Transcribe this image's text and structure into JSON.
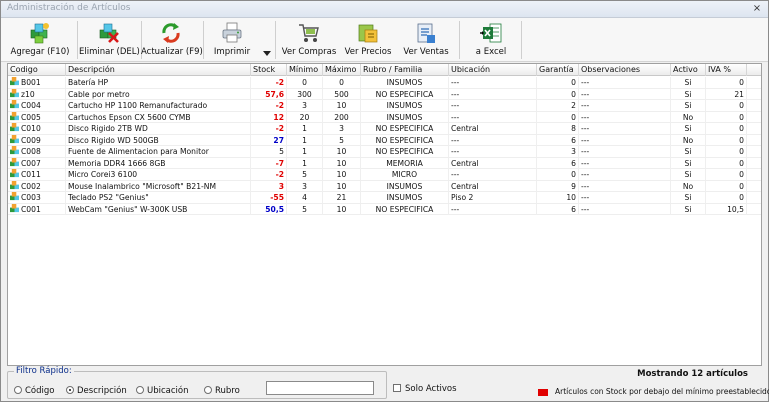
{
  "window": {
    "title": "Administración de Artículos",
    "close_glyph": "×"
  },
  "toolbar": {
    "buttons": [
      {
        "label": "Agregar (F10)",
        "icon": "add-cubes-icon"
      },
      {
        "label": "Eliminar (DEL)",
        "icon": "delete-cubes-icon"
      },
      {
        "label": "Actualizar (F9)",
        "icon": "refresh-icon"
      },
      {
        "label": "Imprimir",
        "icon": "printer-icon"
      },
      {
        "label": "Ver Compras",
        "icon": "cart-icon"
      },
      {
        "label": "Ver Precios",
        "icon": "price-icon"
      },
      {
        "label": "Ver Ventas",
        "icon": "sales-icon"
      },
      {
        "label": "a Excel",
        "icon": "excel-icon"
      }
    ]
  },
  "grid": {
    "headers": [
      "Codigo",
      "Descripción",
      "Stock",
      "Mínimo",
      "Máximo",
      "Rubro / Familia",
      "Ubicación",
      "Garantía",
      "Observaciones",
      "Activo",
      "IVA %"
    ],
    "rows": [
      {
        "codigo": "B001",
        "descripcion": "Batería HP",
        "stock": "-2",
        "stock_state": "neg",
        "minimo": "0",
        "maximo": "0",
        "rubro": "INSUMOS",
        "ubicacion": "---",
        "garantia": "0",
        "observaciones": "---",
        "activo": "Si",
        "iva": "0"
      },
      {
        "codigo": "z10",
        "descripcion": "Cable por metro",
        "stock": "57,6",
        "stock_state": "neg",
        "minimo": "300",
        "maximo": "500",
        "rubro": "NO ESPECIFICA",
        "ubicacion": "---",
        "garantia": "0",
        "observaciones": "---",
        "activo": "Si",
        "iva": "21"
      },
      {
        "codigo": "C004",
        "descripcion": "Cartucho HP 1100 Remanufacturado",
        "stock": "-2",
        "stock_state": "neg",
        "minimo": "3",
        "maximo": "10",
        "rubro": "INSUMOS",
        "ubicacion": "---",
        "garantia": "2",
        "observaciones": "---",
        "activo": "Si",
        "iva": "0"
      },
      {
        "codigo": "C005",
        "descripcion": "Cartuchos Epson CX 5600 CYMB",
        "stock": "12",
        "stock_state": "neg",
        "minimo": "20",
        "maximo": "200",
        "rubro": "INSUMOS",
        "ubicacion": "---",
        "garantia": "0",
        "observaciones": "---",
        "activo": "No",
        "iva": "0"
      },
      {
        "codigo": "C010",
        "descripcion": "Disco Rigido 2TB WD",
        "stock": "-2",
        "stock_state": "neg",
        "minimo": "1",
        "maximo": "3",
        "rubro": "NO ESPECIFICA",
        "ubicacion": "Central",
        "garantia": "8",
        "observaciones": "---",
        "activo": "Si",
        "iva": "0"
      },
      {
        "codigo": "C009",
        "descripcion": "Disco Rigido WD 500GB",
        "stock": "27",
        "stock_state": "pos",
        "minimo": "1",
        "maximo": "5",
        "rubro": "NO ESPECIFICA",
        "ubicacion": "---",
        "garantia": "6",
        "observaciones": "---",
        "activo": "No",
        "iva": "0"
      },
      {
        "codigo": "C008",
        "descripcion": "Fuente de Alimentacion para Monitor",
        "stock": "5",
        "stock_state": "normal",
        "minimo": "1",
        "maximo": "10",
        "rubro": "NO ESPECIFICA",
        "ubicacion": "---",
        "garantia": "3",
        "observaciones": "---",
        "activo": "Si",
        "iva": "0"
      },
      {
        "codigo": "C007",
        "descripcion": "Memoria DDR4 1666 8GB",
        "stock": "-7",
        "stock_state": "neg",
        "minimo": "1",
        "maximo": "10",
        "rubro": "MEMORIA",
        "ubicacion": "Central",
        "garantia": "6",
        "observaciones": "---",
        "activo": "Si",
        "iva": "0"
      },
      {
        "codigo": "C011",
        "descripcion": "Micro Corei3 6100",
        "stock": "-2",
        "stock_state": "neg",
        "minimo": "5",
        "maximo": "10",
        "rubro": "MICRO",
        "ubicacion": "---",
        "garantia": "0",
        "observaciones": "---",
        "activo": "Si",
        "iva": "0"
      },
      {
        "codigo": "C002",
        "descripcion": "Mouse Inalambrico \"Microsoft\" B21-NM",
        "stock": "3",
        "stock_state": "neg",
        "minimo": "3",
        "maximo": "10",
        "rubro": "INSUMOS",
        "ubicacion": "Central",
        "garantia": "9",
        "observaciones": "---",
        "activo": "No",
        "iva": "0"
      },
      {
        "codigo": "C003",
        "descripcion": "Teclado PS2 \"Genius\"",
        "stock": "-55",
        "stock_state": "neg",
        "minimo": "4",
        "maximo": "21",
        "rubro": "INSUMOS",
        "ubicacion": "Piso 2",
        "garantia": "10",
        "observaciones": "---",
        "activo": "Si",
        "iva": "0"
      },
      {
        "codigo": "C001",
        "descripcion": "WebCam \"Genius\" W-300K USB",
        "stock": "50,5",
        "stock_state": "pos",
        "minimo": "5",
        "maximo": "10",
        "rubro": "NO ESPECIFICA",
        "ubicacion": "---",
        "garantia": "6",
        "observaciones": "---",
        "activo": "Si",
        "iva": "10,5"
      }
    ]
  },
  "filter": {
    "title": "Filtro Rápido:",
    "options": [
      {
        "label": "Código",
        "selected": false
      },
      {
        "label": "Descripción",
        "selected": true
      },
      {
        "label": "Ubicación",
        "selected": false
      },
      {
        "label": "Rubro",
        "selected": false
      }
    ],
    "search_value": "",
    "solo_activos_label": "Solo Activos",
    "solo_activos_checked": false
  },
  "status": {
    "count_text": "Mostrando 12 artículos",
    "legend_text": "Artículos con Stock por debajo del mínimo preestablecido",
    "legend_color": "#e00000"
  }
}
